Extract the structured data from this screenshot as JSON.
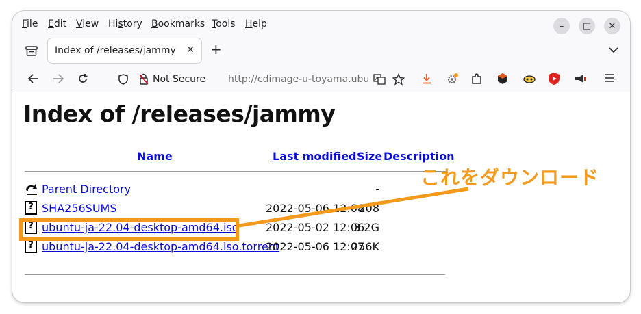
{
  "menubar": {
    "items": [
      "File",
      "Edit",
      "View",
      "History",
      "Bookmarks",
      "Tools",
      "Help"
    ],
    "underline": [
      "F",
      "E",
      "V",
      "s",
      "B",
      "T",
      "H"
    ]
  },
  "window_controls": {
    "minimize": "–",
    "maximize": "□",
    "close": "✕"
  },
  "tab": {
    "title": "Index of /releases/jammy",
    "close": "✕",
    "new_tab": "+"
  },
  "nav": {
    "not_secure": "Not Secure",
    "url": "http://cdimage-u-toyama.ubu"
  },
  "page": {
    "heading": "Index of /releases/jammy",
    "columns": {
      "name": "Name",
      "last_modified": "Last modified",
      "size": "Size",
      "description": "Description"
    },
    "rows": [
      {
        "name": "Parent Directory",
        "date": "",
        "size": "-",
        "icon": "back-icon"
      },
      {
        "name": "SHA256SUMS",
        "date": "2022-05-06 12:08",
        "size": "208",
        "icon": "unknown-file-icon"
      },
      {
        "name": "ubuntu-ja-22.04-desktop-amd64.iso",
        "date": "2022-05-02 12:06",
        "size": "3.2G",
        "icon": "unknown-file-icon"
      },
      {
        "name": "ubuntu-ja-22.04-desktop-amd64.iso.torrent",
        "date": "2022-05-06 12:07",
        "size": "256K",
        "icon": "unknown-file-icon"
      }
    ]
  },
  "annotation": {
    "text": "これをダウンロード",
    "color": "#f39a1d"
  },
  "colors": {
    "link": "#0b0bd8",
    "accent": "#f39a1d"
  }
}
